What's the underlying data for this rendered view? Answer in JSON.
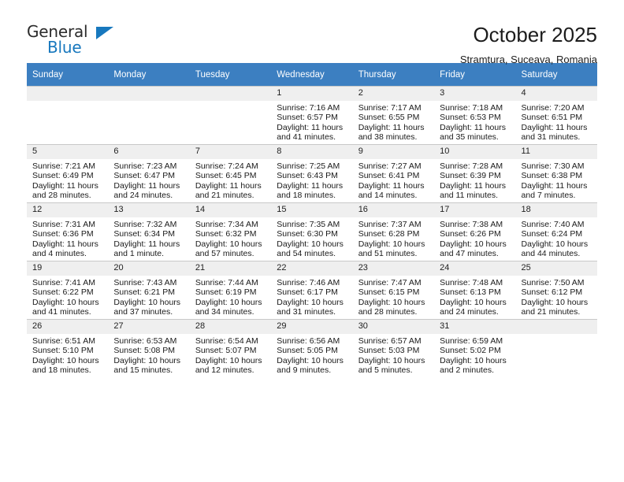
{
  "brand": {
    "name_part1": "General",
    "name_part2": "Blue",
    "triangle_icon": "triangle-icon",
    "accent_color": "#1878be"
  },
  "header": {
    "title": "October 2025",
    "subtitle": "Stramtura, Suceava, Romania"
  },
  "theme": {
    "header_row_bg": "#3c7fc1",
    "daynum_band_bg": "#efefef",
    "grid_line": "#c8c8c8"
  },
  "calendar": {
    "weekday_headers": [
      "Sunday",
      "Monday",
      "Tuesday",
      "Wednesday",
      "Thursday",
      "Friday",
      "Saturday"
    ],
    "weeks": [
      [
        {
          "day": "",
          "sunrise": "",
          "sunset": "",
          "daylight_1": "",
          "daylight_2": "",
          "empty": true
        },
        {
          "day": "",
          "sunrise": "",
          "sunset": "",
          "daylight_1": "",
          "daylight_2": "",
          "empty": true
        },
        {
          "day": "",
          "sunrise": "",
          "sunset": "",
          "daylight_1": "",
          "daylight_2": "",
          "empty": true
        },
        {
          "day": "1",
          "sunrise": "Sunrise: 7:16 AM",
          "sunset": "Sunset: 6:57 PM",
          "daylight_1": "Daylight: 11 hours",
          "daylight_2": "and 41 minutes."
        },
        {
          "day": "2",
          "sunrise": "Sunrise: 7:17 AM",
          "sunset": "Sunset: 6:55 PM",
          "daylight_1": "Daylight: 11 hours",
          "daylight_2": "and 38 minutes."
        },
        {
          "day": "3",
          "sunrise": "Sunrise: 7:18 AM",
          "sunset": "Sunset: 6:53 PM",
          "daylight_1": "Daylight: 11 hours",
          "daylight_2": "and 35 minutes."
        },
        {
          "day": "4",
          "sunrise": "Sunrise: 7:20 AM",
          "sunset": "Sunset: 6:51 PM",
          "daylight_1": "Daylight: 11 hours",
          "daylight_2": "and 31 minutes."
        }
      ],
      [
        {
          "day": "5",
          "sunrise": "Sunrise: 7:21 AM",
          "sunset": "Sunset: 6:49 PM",
          "daylight_1": "Daylight: 11 hours",
          "daylight_2": "and 28 minutes."
        },
        {
          "day": "6",
          "sunrise": "Sunrise: 7:23 AM",
          "sunset": "Sunset: 6:47 PM",
          "daylight_1": "Daylight: 11 hours",
          "daylight_2": "and 24 minutes."
        },
        {
          "day": "7",
          "sunrise": "Sunrise: 7:24 AM",
          "sunset": "Sunset: 6:45 PM",
          "daylight_1": "Daylight: 11 hours",
          "daylight_2": "and 21 minutes."
        },
        {
          "day": "8",
          "sunrise": "Sunrise: 7:25 AM",
          "sunset": "Sunset: 6:43 PM",
          "daylight_1": "Daylight: 11 hours",
          "daylight_2": "and 18 minutes."
        },
        {
          "day": "9",
          "sunrise": "Sunrise: 7:27 AM",
          "sunset": "Sunset: 6:41 PM",
          "daylight_1": "Daylight: 11 hours",
          "daylight_2": "and 14 minutes."
        },
        {
          "day": "10",
          "sunrise": "Sunrise: 7:28 AM",
          "sunset": "Sunset: 6:39 PM",
          "daylight_1": "Daylight: 11 hours",
          "daylight_2": "and 11 minutes."
        },
        {
          "day": "11",
          "sunrise": "Sunrise: 7:30 AM",
          "sunset": "Sunset: 6:38 PM",
          "daylight_1": "Daylight: 11 hours",
          "daylight_2": "and 7 minutes."
        }
      ],
      [
        {
          "day": "12",
          "sunrise": "Sunrise: 7:31 AM",
          "sunset": "Sunset: 6:36 PM",
          "daylight_1": "Daylight: 11 hours",
          "daylight_2": "and 4 minutes."
        },
        {
          "day": "13",
          "sunrise": "Sunrise: 7:32 AM",
          "sunset": "Sunset: 6:34 PM",
          "daylight_1": "Daylight: 11 hours",
          "daylight_2": "and 1 minute."
        },
        {
          "day": "14",
          "sunrise": "Sunrise: 7:34 AM",
          "sunset": "Sunset: 6:32 PM",
          "daylight_1": "Daylight: 10 hours",
          "daylight_2": "and 57 minutes."
        },
        {
          "day": "15",
          "sunrise": "Sunrise: 7:35 AM",
          "sunset": "Sunset: 6:30 PM",
          "daylight_1": "Daylight: 10 hours",
          "daylight_2": "and 54 minutes."
        },
        {
          "day": "16",
          "sunrise": "Sunrise: 7:37 AM",
          "sunset": "Sunset: 6:28 PM",
          "daylight_1": "Daylight: 10 hours",
          "daylight_2": "and 51 minutes."
        },
        {
          "day": "17",
          "sunrise": "Sunrise: 7:38 AM",
          "sunset": "Sunset: 6:26 PM",
          "daylight_1": "Daylight: 10 hours",
          "daylight_2": "and 47 minutes."
        },
        {
          "day": "18",
          "sunrise": "Sunrise: 7:40 AM",
          "sunset": "Sunset: 6:24 PM",
          "daylight_1": "Daylight: 10 hours",
          "daylight_2": "and 44 minutes."
        }
      ],
      [
        {
          "day": "19",
          "sunrise": "Sunrise: 7:41 AM",
          "sunset": "Sunset: 6:22 PM",
          "daylight_1": "Daylight: 10 hours",
          "daylight_2": "and 41 minutes."
        },
        {
          "day": "20",
          "sunrise": "Sunrise: 7:43 AM",
          "sunset": "Sunset: 6:21 PM",
          "daylight_1": "Daylight: 10 hours",
          "daylight_2": "and 37 minutes."
        },
        {
          "day": "21",
          "sunrise": "Sunrise: 7:44 AM",
          "sunset": "Sunset: 6:19 PM",
          "daylight_1": "Daylight: 10 hours",
          "daylight_2": "and 34 minutes."
        },
        {
          "day": "22",
          "sunrise": "Sunrise: 7:46 AM",
          "sunset": "Sunset: 6:17 PM",
          "daylight_1": "Daylight: 10 hours",
          "daylight_2": "and 31 minutes."
        },
        {
          "day": "23",
          "sunrise": "Sunrise: 7:47 AM",
          "sunset": "Sunset: 6:15 PM",
          "daylight_1": "Daylight: 10 hours",
          "daylight_2": "and 28 minutes."
        },
        {
          "day": "24",
          "sunrise": "Sunrise: 7:48 AM",
          "sunset": "Sunset: 6:13 PM",
          "daylight_1": "Daylight: 10 hours",
          "daylight_2": "and 24 minutes."
        },
        {
          "day": "25",
          "sunrise": "Sunrise: 7:50 AM",
          "sunset": "Sunset: 6:12 PM",
          "daylight_1": "Daylight: 10 hours",
          "daylight_2": "and 21 minutes."
        }
      ],
      [
        {
          "day": "26",
          "sunrise": "Sunrise: 6:51 AM",
          "sunset": "Sunset: 5:10 PM",
          "daylight_1": "Daylight: 10 hours",
          "daylight_2": "and 18 minutes."
        },
        {
          "day": "27",
          "sunrise": "Sunrise: 6:53 AM",
          "sunset": "Sunset: 5:08 PM",
          "daylight_1": "Daylight: 10 hours",
          "daylight_2": "and 15 minutes."
        },
        {
          "day": "28",
          "sunrise": "Sunrise: 6:54 AM",
          "sunset": "Sunset: 5:07 PM",
          "daylight_1": "Daylight: 10 hours",
          "daylight_2": "and 12 minutes."
        },
        {
          "day": "29",
          "sunrise": "Sunrise: 6:56 AM",
          "sunset": "Sunset: 5:05 PM",
          "daylight_1": "Daylight: 10 hours",
          "daylight_2": "and 9 minutes."
        },
        {
          "day": "30",
          "sunrise": "Sunrise: 6:57 AM",
          "sunset": "Sunset: 5:03 PM",
          "daylight_1": "Daylight: 10 hours",
          "daylight_2": "and 5 minutes."
        },
        {
          "day": "31",
          "sunrise": "Sunrise: 6:59 AM",
          "sunset": "Sunset: 5:02 PM",
          "daylight_1": "Daylight: 10 hours",
          "daylight_2": "and 2 minutes."
        },
        {
          "day": "",
          "sunrise": "",
          "sunset": "",
          "daylight_1": "",
          "daylight_2": "",
          "empty": true
        }
      ]
    ]
  }
}
